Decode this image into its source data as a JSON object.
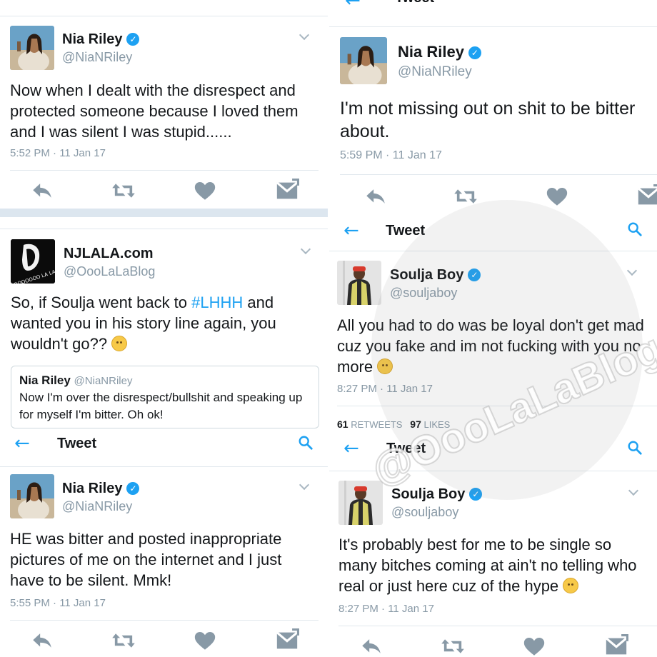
{
  "colors": {
    "accent": "#1da1f2",
    "text": "#14171a",
    "muted": "#8899a6",
    "divider": "#e1e8ed",
    "strip": "#dce6ef"
  },
  "icons": {
    "back": "arrow-left-icon",
    "search": "search-icon",
    "verified": "verified-badge-icon",
    "reply": "reply-icon",
    "retweet": "retweet-icon",
    "like": "heart-icon",
    "dm": "envelope-icon",
    "caret": "chevron-down-icon"
  },
  "topbar_title": "Tweet",
  "watermark": "@OooLaLaBlog",
  "tweets": {
    "nia1": {
      "name": "Nia Riley",
      "handle": "@NiaNRiley",
      "text": "Now when I dealt with the disrespect and protected someone because I loved them and I was silent I was stupid......",
      "meta": "5:52 PM · 11 Jan 17"
    },
    "nia2": {
      "name": "Nia Riley",
      "handle": "@NiaNRiley",
      "text": "I'm not missing out on shit to be bitter about.",
      "meta": "5:59 PM · 11 Jan 17"
    },
    "njlala": {
      "name": "NJLALA.com",
      "handle": "@OooLaLaBlog",
      "text_a": "So, if Soulja went back to ",
      "hashtag": "#LHHH",
      "text_b": " and wanted you in his story line again, you wouldn't go??",
      "avatar_text": "OOOOOOO LA LA!",
      "quote": {
        "name": "Nia Riley",
        "handle": "@NiaNRiley",
        "text": "Now I'm over the disrespect/bullshit and speaking up for myself I'm bitter. Oh ok!"
      }
    },
    "soulja1": {
      "name": "Soulja Boy",
      "handle": "@souljaboy",
      "text": "All you had to do was be loyal don't get mad cuz you fake and im not fucking with you no more",
      "meta": "8:27 PM · 11 Jan 17",
      "retweets": "61",
      "retweets_label": "RETWEETS",
      "likes": "97",
      "likes_label": "LIKES"
    },
    "nia3": {
      "name": "Nia Riley",
      "handle": "@NiaNRiley",
      "text": "HE was bitter and posted inappropriate pictures of me on the internet and I just have to be silent. Mmk!",
      "meta": "5:55 PM · 11 Jan 17"
    },
    "soulja2": {
      "name": "Soulja Boy",
      "handle": "@souljaboy",
      "text": "It's probably best for me to be single so many bitches coming at ain't no telling who real or just here cuz of the hype",
      "meta": "8:27 PM · 11 Jan 17"
    }
  }
}
